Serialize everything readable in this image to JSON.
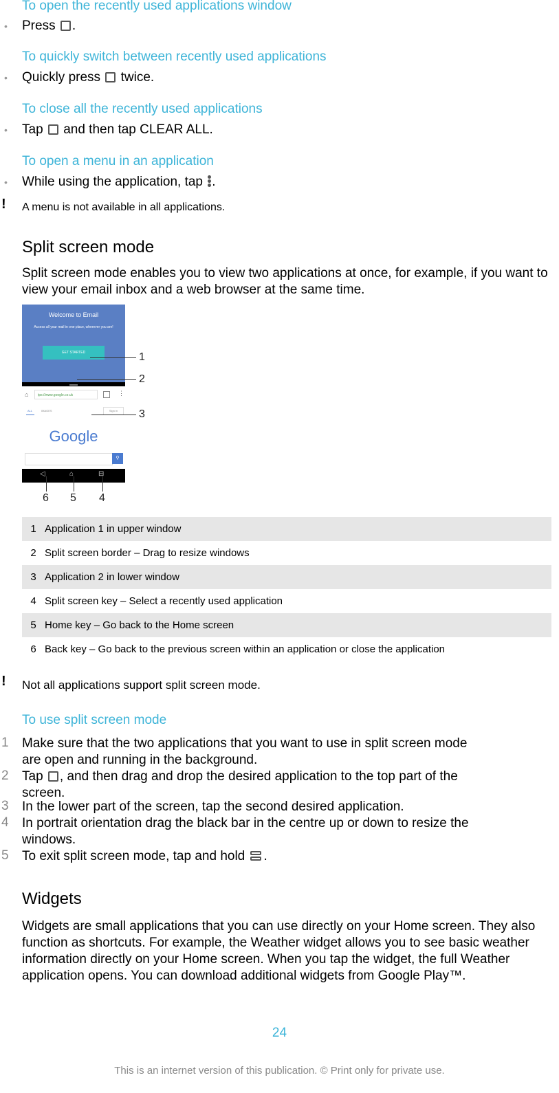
{
  "procedures": [
    {
      "title": "To open the recently used applications window",
      "step_before": "Press",
      "icon": "recent-apps-icon",
      "step_after": "."
    },
    {
      "title": "To quickly switch between recently used applications",
      "step_before": "Quickly press",
      "icon": "recent-apps-icon",
      "step_after": "twice."
    },
    {
      "title": "To close all the recently used applications",
      "step_before": "Tap",
      "icon": "recent-apps-icon",
      "step_mid": "and then tap",
      "step_bold": "CLEAR ALL",
      "step_after": "."
    },
    {
      "title": "To open a menu in an application",
      "step_before": "While using the application, tap",
      "icon": "menu-dots-icon",
      "step_after": "."
    }
  ],
  "note1": "A menu is not available in all applications.",
  "split": {
    "heading": "Split screen mode",
    "intro": "Split screen mode enables you to view two applications at once, for example, if you want to view your email inbox and a web browser at the same time.",
    "figure": {
      "email_title": "Welcome to Email",
      "email_sub": "Access all your mail in one place, wherever you are!",
      "email_button": "GET STARTED",
      "url": "tps://www.google.co.uk",
      "tab_all": "ALL",
      "tab_images": "IMAGES",
      "sign_in": "Sign in",
      "logo": "Google",
      "callouts": [
        "1",
        "2",
        "3",
        "4",
        "5",
        "6"
      ]
    },
    "legend": [
      {
        "n": "1",
        "text": "Application 1 in upper window"
      },
      {
        "n": "2",
        "text": "Split screen border – Drag to resize windows"
      },
      {
        "n": "3",
        "text": "Application 2 in lower window"
      },
      {
        "n": "4",
        "text": "Split screen key – Select a recently used application"
      },
      {
        "n": "5",
        "text": "Home key – Go back to the Home screen"
      },
      {
        "n": "6",
        "text": "Back key – Go back to the previous screen within an application or close the application"
      }
    ],
    "note2": "Not all applications support split screen mode.",
    "use_title": "To use split screen mode",
    "steps": [
      {
        "n": "1",
        "line1": "Make sure that the two applications that you want to use in split screen mode",
        "line2": "are open and running in the background."
      },
      {
        "n": "2",
        "line1_before": "Tap",
        "line1_after": ", and then drag and drop the desired application to the top part of the",
        "line2": "screen."
      },
      {
        "n": "3",
        "line1": "In the lower part of the screen, tap the second desired application."
      },
      {
        "n": "4",
        "line1": "In portrait orientation drag the black bar in the centre up or down to resize the",
        "line2": "windows."
      },
      {
        "n": "5",
        "line1_before": "To exit split screen mode, tap and hold",
        "line1_after": "."
      }
    ]
  },
  "widgets": {
    "heading": "Widgets",
    "text": "Widgets are small applications that you can use directly on your Home screen. They also function as shortcuts. For example, the Weather widget allows you to see basic weather information directly on your Home screen. When you tap the widget, the full Weather application opens. You can download additional widgets from Google Play™."
  },
  "footer": {
    "page": "24",
    "note": "This is an internet version of this publication. © Print only for private use."
  }
}
